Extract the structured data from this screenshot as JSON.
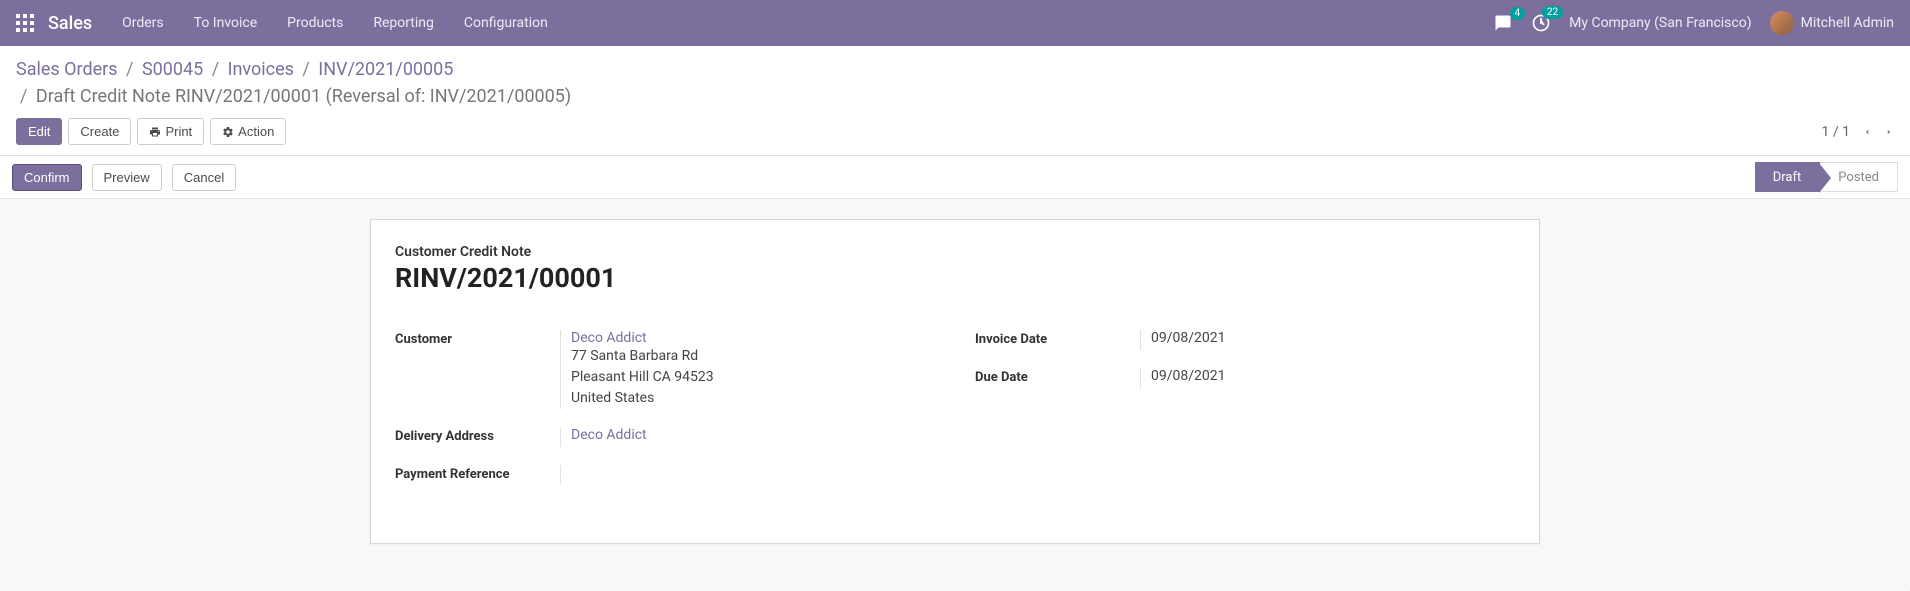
{
  "navbar": {
    "app_title": "Sales",
    "menu": [
      "Orders",
      "To Invoice",
      "Products",
      "Reporting",
      "Configuration"
    ],
    "messages_badge": "4",
    "activities_badge": "22",
    "company": "My Company (San Francisco)",
    "user": "Mitchell Admin"
  },
  "breadcrumb": {
    "items": [
      "Sales Orders",
      "S00045",
      "Invoices",
      "INV/2021/00005"
    ],
    "current": "Draft Credit Note RINV/2021/00001 (Reversal of: INV/2021/00005)"
  },
  "toolbar": {
    "edit": "Edit",
    "create": "Create",
    "print": "Print",
    "action": "Action",
    "pager_current": "1",
    "pager_total": "1"
  },
  "statusbar": {
    "confirm": "Confirm",
    "preview": "Preview",
    "cancel": "Cancel",
    "steps": {
      "draft": "Draft",
      "posted": "Posted"
    },
    "active_step": "draft"
  },
  "form": {
    "doc_label": "Customer Credit Note",
    "doc_title": "RINV/2021/00001",
    "left": {
      "customer_label": "Customer",
      "customer_name": "Deco Addict",
      "customer_addr1": "77 Santa Barbara Rd",
      "customer_addr2": "Pleasant Hill CA 94523",
      "customer_country": "United States",
      "delivery_label": "Delivery Address",
      "delivery_value": "Deco Addict",
      "payref_label": "Payment Reference",
      "payref_value": ""
    },
    "right": {
      "invoice_date_label": "Invoice Date",
      "invoice_date_value": "09/08/2021",
      "due_date_label": "Due Date",
      "due_date_value": "09/08/2021"
    }
  }
}
